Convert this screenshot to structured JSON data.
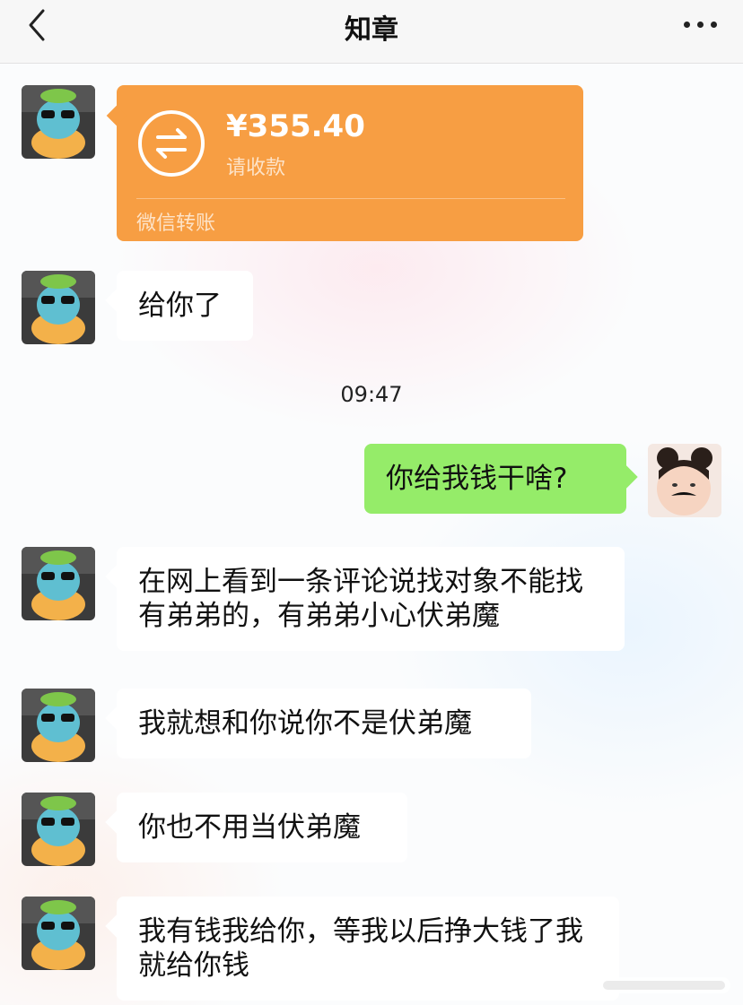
{
  "header": {
    "title": "知章"
  },
  "transfer": {
    "amount": "¥355.40",
    "status": "请收款",
    "footer": "微信转账"
  },
  "messages": [
    {
      "text": "给你了"
    },
    {
      "text": "你给我钱干啥?"
    },
    {
      "text": "在网上看到一条评论说找对象不能找有弟弟的，有弟弟小心伏弟魔"
    },
    {
      "text": "我就想和你说你不是伏弟魔"
    },
    {
      "text": "你也不用当伏弟魔"
    },
    {
      "text": "我有钱我给你，等我以后挣大钱了我就给你钱"
    }
  ],
  "timestamp": "09:47",
  "colors": {
    "transfer": "#f79e43",
    "outgoing": "#95ec69",
    "incoming": "#ffffff"
  }
}
